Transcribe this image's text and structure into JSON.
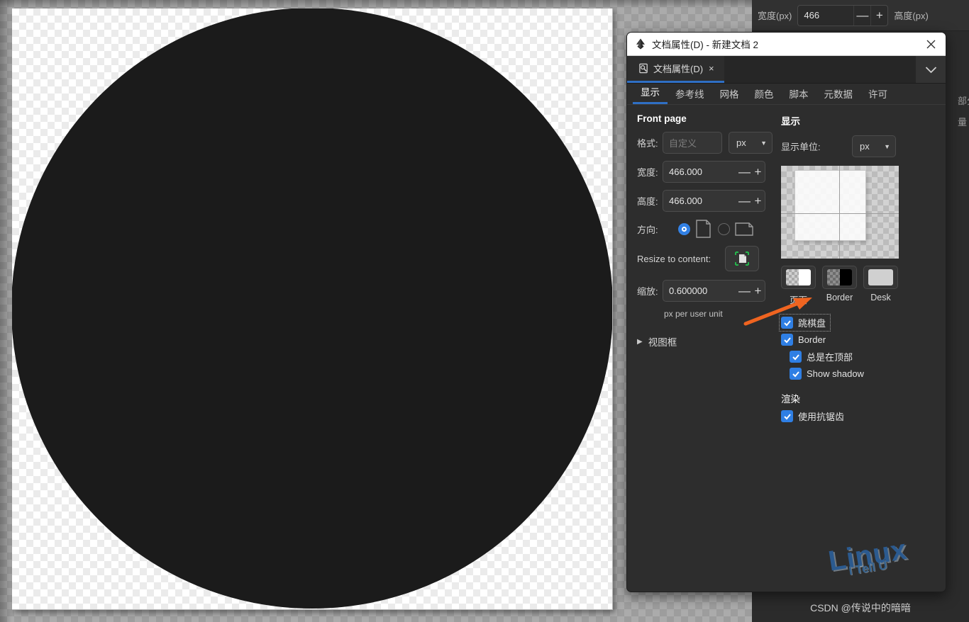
{
  "toolbar": {
    "width_label": "宽度(px)",
    "width_value": "466",
    "height_label": "高度(px)",
    "minus": "—",
    "plus": "+"
  },
  "right_edge": {
    "line1": "部分",
    "line2": "量"
  },
  "dialog": {
    "title": "文档属性(D) - 新建文档 2",
    "close_icon": "close-icon",
    "dock_tab": {
      "label": "文档属性(D)",
      "close": "×"
    },
    "chevron": "⌄",
    "inner_tabs": [
      {
        "label": "显示",
        "active": true
      },
      {
        "label": "参考线",
        "active": false
      },
      {
        "label": "网格",
        "active": false
      },
      {
        "label": "颜色",
        "active": false
      },
      {
        "label": "脚本",
        "active": false
      },
      {
        "label": "元数据",
        "active": false
      },
      {
        "label": "许可",
        "active": false
      }
    ],
    "left": {
      "section_title": "Front page",
      "format_label": "格式:",
      "format_placeholder": "自定义",
      "format_unit": "px",
      "width_label": "宽度:",
      "width_value": "466.000",
      "height_label": "高度:",
      "height_value": "466.000",
      "orientation_label": "方向:",
      "resize_label": "Resize to content:",
      "scale_label": "缩放:",
      "scale_value": "0.600000",
      "scale_hint": "px per user unit",
      "viewbox_label": "视图框",
      "minus": "—",
      "plus": "+",
      "combo_arrow": "▼"
    },
    "right": {
      "section_title": "显示",
      "unit_label": "显示单位:",
      "unit_value": "px",
      "combo_arrow": "▼",
      "swatches": [
        {
          "label": "页面",
          "color": "#ffffff"
        },
        {
          "label": "Border",
          "color": "#000000"
        },
        {
          "label": "Desk",
          "color": "#d0d0d0"
        }
      ],
      "checkboxes": [
        {
          "label": "跳棋盘",
          "checked": true,
          "indent": false,
          "focused": true
        },
        {
          "label": "Border",
          "checked": true,
          "indent": false,
          "focused": false
        },
        {
          "label": "总是在顶部",
          "checked": true,
          "indent": true,
          "focused": false
        },
        {
          "label": "Show shadow",
          "checked": true,
          "indent": true,
          "focused": false
        }
      ],
      "render_title": "渲染",
      "render_checkbox": {
        "label": "使用抗锯齿",
        "checked": true
      }
    }
  },
  "watermark": {
    "line1": "Linux",
    "line2": "I Tell U"
  },
  "footer": {
    "credit": "CSDN @传说中的暗暗"
  },
  "colors": {
    "accent": "#2f7fe4",
    "tab_underline": "#2f6fc4",
    "dialog_bg": "#2d2d2d",
    "annotation": "#ef6420",
    "canvas_object": "#1b1b1b"
  }
}
